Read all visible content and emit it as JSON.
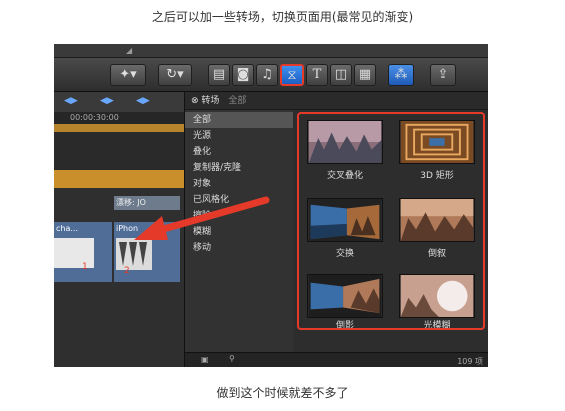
{
  "captions": {
    "top": "之后可以加一些转场，切换页面用(最常见的渐变)",
    "bottom": "做到这个时候就差不多了"
  },
  "toolbar": {
    "timecode": "00:00:30:00",
    "tools": [
      "magic-wand-icon",
      "rotate-icon",
      "clips-icon",
      "camera-icon",
      "music-icon",
      "transition-icon",
      "text-icon",
      "generator-icon",
      "theme-icon",
      "share-icon"
    ],
    "text_tool_label": "T"
  },
  "timeline": {
    "clip_label_top": "漂移: JO",
    "clip_a_label": "cha...",
    "clip_b_label": "iPhon",
    "clip_a_number": "1",
    "clip_b_number": "2"
  },
  "browser": {
    "title": "转场",
    "subtitle": "全部",
    "categories": [
      "全部",
      "光源",
      "叠化",
      "复制器/克隆",
      "对象",
      "已风格化",
      "擦除",
      "模糊",
      "移动"
    ],
    "selected_category": "全部",
    "transitions": [
      {
        "label": "交叉叠化"
      },
      {
        "label": "3D 矩形"
      },
      {
        "label": "交换"
      },
      {
        "label": "倒叙"
      },
      {
        "label": "倒影"
      },
      {
        "label": "光模糊"
      }
    ],
    "count_text": "109 项"
  },
  "colors": {
    "highlight_red": "#e53a2a",
    "accent_blue": "#2f7fe0",
    "timeline_orange": "#c98f2b"
  }
}
